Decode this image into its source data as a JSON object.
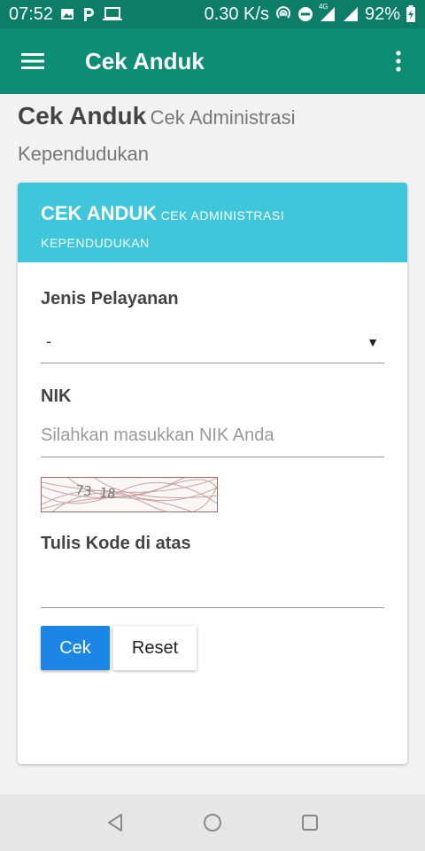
{
  "status_bar": {
    "time": "07:52",
    "speed": "0.30 K/s",
    "network_badge": "4G",
    "battery": "92%"
  },
  "toolbar": {
    "title": "Cek Anduk"
  },
  "heading": {
    "main": "Cek Anduk",
    "sub": "Cek Administrasi Kependudukan"
  },
  "card": {
    "header_main": "CEK ANDUK",
    "header_sub": "CEK ADMINISTRASI KEPENDUDUKAN",
    "jenis_label": "Jenis Pelayanan",
    "jenis_value": "-",
    "nik_label": "NIK",
    "nik_placeholder": "Silahkan masukkan NIK Anda",
    "captcha_text": "73 18",
    "kode_label": "Tulis Kode di atas",
    "cek_label": "Cek",
    "reset_label": "Reset"
  },
  "colors": {
    "status_bar": "#0c7d67",
    "toolbar": "#0e8d75",
    "card_header": "#3ec7da",
    "primary_button": "#1c86e6"
  }
}
